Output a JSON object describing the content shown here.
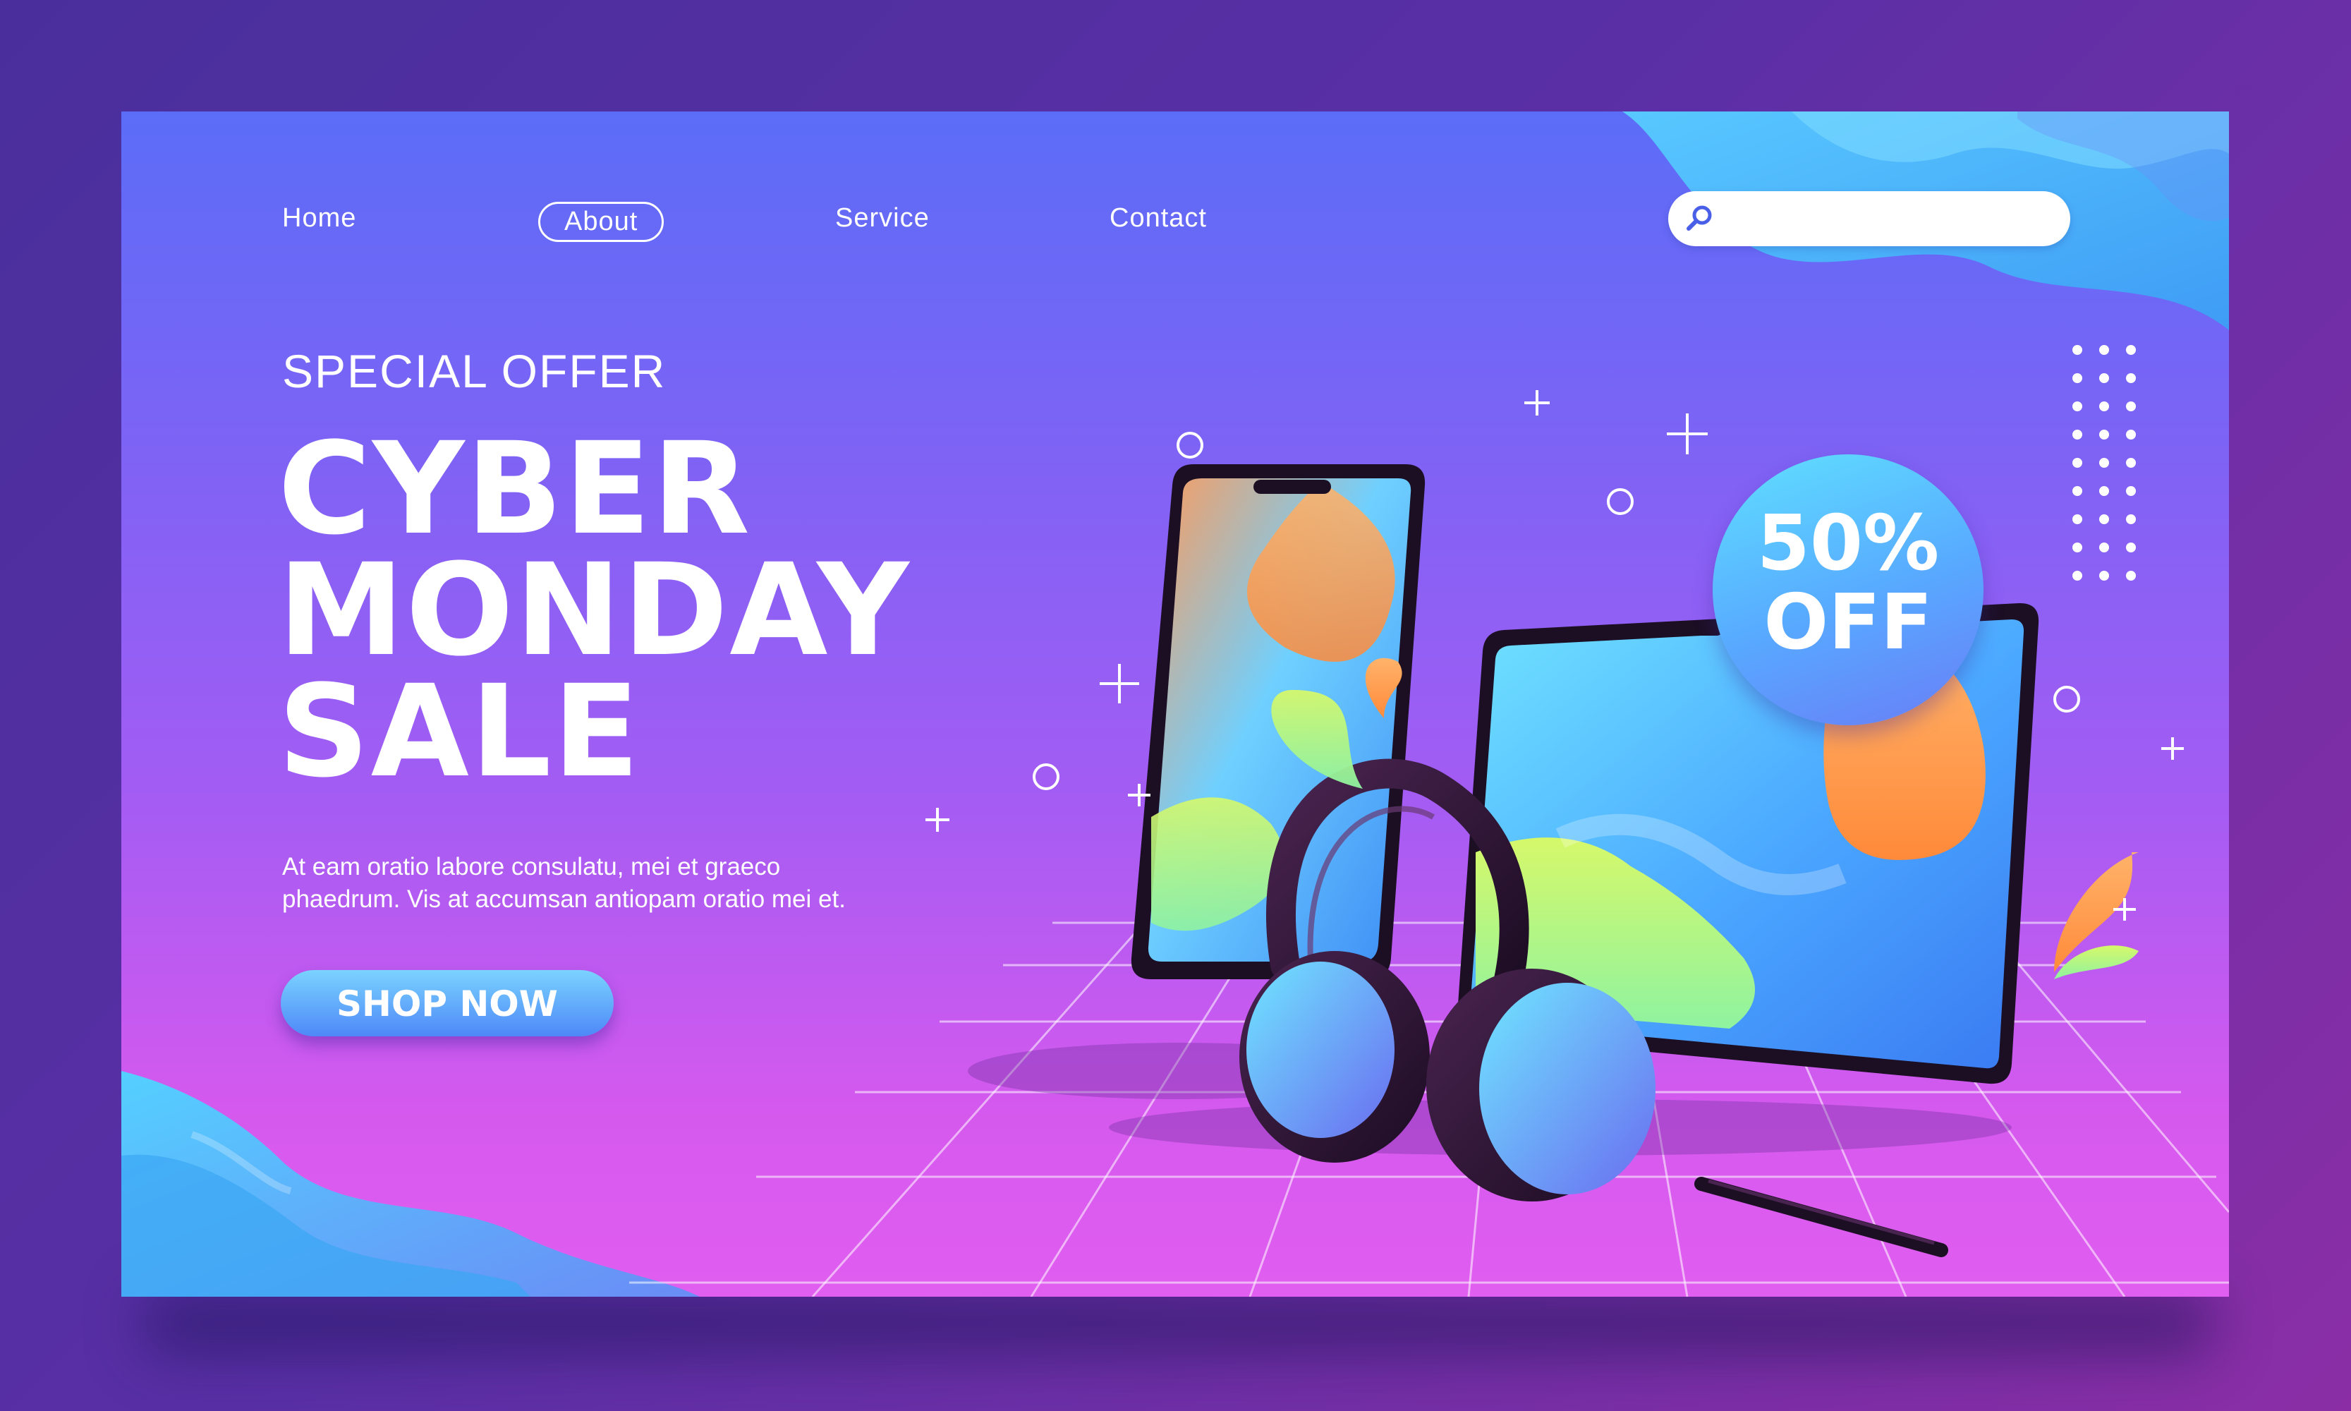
{
  "nav": {
    "items": [
      {
        "label": "Home"
      },
      {
        "label": "About",
        "active": true
      },
      {
        "label": "Service"
      },
      {
        "label": "Contact"
      }
    ],
    "search": {
      "placeholder": "",
      "value": "",
      "icon": "search-icon"
    }
  },
  "hero": {
    "eyebrow": "SPECIAL OFFER",
    "headline": [
      "CYBER",
      "MONDAY",
      "SALE"
    ],
    "description": [
      "At eam oratio labore consulatu, mei et graeco",
      "phaedrum. Vis at accumsan antiopam oratio mei et."
    ],
    "cta_label": "SHOP NOW"
  },
  "badge": {
    "percent": "50%",
    "label": "OFF"
  },
  "colors": {
    "accent_blue": "#5fe0ff",
    "accent_purple": "#7d63f5",
    "accent_pink": "#e05ef0",
    "button_gradient_top": "#7ad3ff",
    "button_gradient_bottom": "#4e88f8"
  }
}
